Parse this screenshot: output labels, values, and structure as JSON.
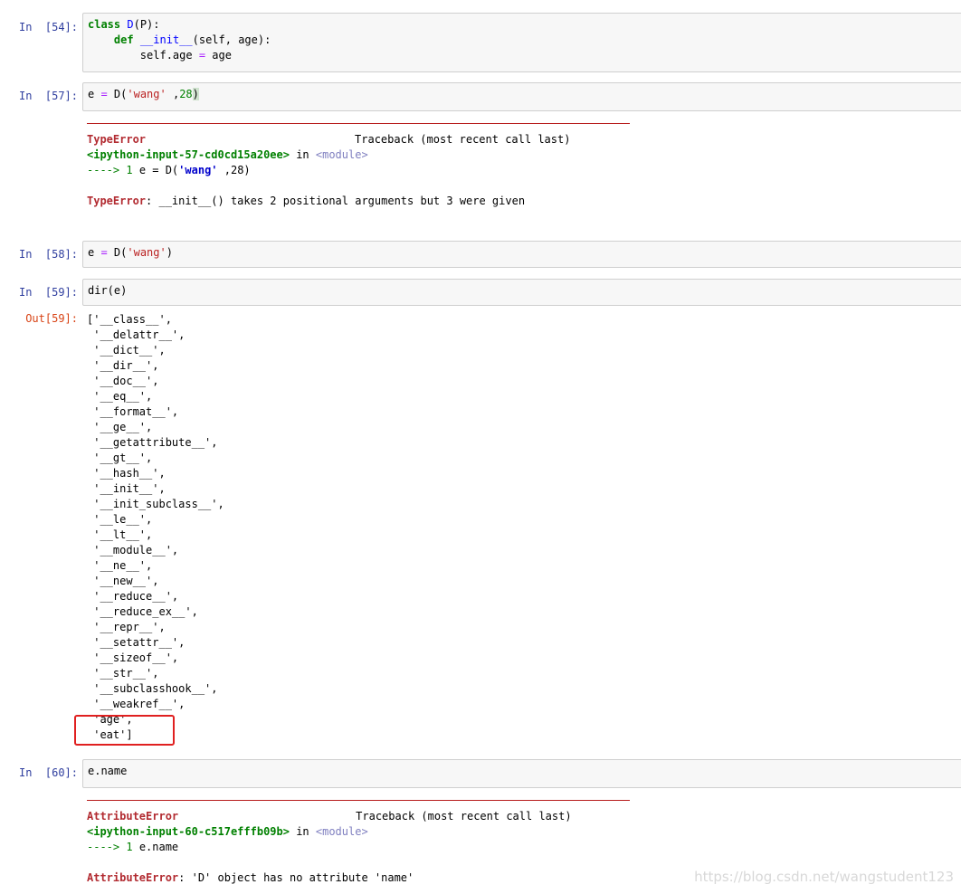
{
  "cells": {
    "c54": {
      "prompt": "In  [54]:",
      "line1": {
        "kw": "class",
        "sp": " ",
        "name": "D",
        "rest": "(P):"
      },
      "line2": {
        "indent": "    ",
        "kw": "def",
        "sp": " ",
        "fn": "__init__",
        "rest": "(self, age):"
      },
      "line3": {
        "indent": "        ",
        "lhs": "self.age ",
        "op": "=",
        "rhs": " age"
      }
    },
    "c57": {
      "prompt": "In  [57]:",
      "code": {
        "lhs": "e ",
        "op": "=",
        "call": " D(",
        "str": "'wang'",
        "sep": " ,",
        "num": "28",
        "close": ")"
      },
      "error": {
        "name": "TypeError",
        "traceback": "Traceback (most recent call last)",
        "input_ref": "<ipython-input-57-cd0cd15a20ee>",
        "in_word": " in ",
        "module": "<module>",
        "arrow": "---->",
        "line_no": " 1 ",
        "line_a": "e = D(",
        "line_str": "'wang'",
        "line_b": " ,28)",
        "message": ": __init__() takes 2 positional arguments but 3 were given"
      }
    },
    "c58": {
      "prompt": "In  [58]:",
      "code": {
        "lhs": "e ",
        "op": "=",
        "call": " D(",
        "str": "'wang'",
        "close": ")"
      }
    },
    "c59": {
      "prompt": "In  [59]:",
      "code": "dir(e)",
      "out_prompt": "Out[59]:",
      "output_lines": [
        "['__class__',",
        " '__delattr__',",
        " '__dict__',",
        " '__dir__',",
        " '__doc__',",
        " '__eq__',",
        " '__format__',",
        " '__ge__',",
        " '__getattribute__',",
        " '__gt__',",
        " '__hash__',",
        " '__init__',",
        " '__init_subclass__',",
        " '__le__',",
        " '__lt__',",
        " '__module__',",
        " '__ne__',",
        " '__new__',",
        " '__reduce__',",
        " '__reduce_ex__',",
        " '__repr__',",
        " '__setattr__',",
        " '__sizeof__',",
        " '__str__',",
        " '__subclasshook__',",
        " '__weakref__',",
        " 'age',",
        " 'eat']"
      ]
    },
    "c60": {
      "prompt": "In  [60]:",
      "code": "e.name",
      "error": {
        "name": "AttributeError",
        "traceback": "Traceback (most recent call last)",
        "input_ref": "<ipython-input-60-c517efffb09b>",
        "in_word": " in ",
        "module": "<module>",
        "arrow": "---->",
        "line_no": " 1 ",
        "line": "e.name",
        "message": ": 'D' object has no attribute 'name'"
      }
    }
  },
  "watermark": "https://blog.csdn.net/wangstudent123",
  "colors": {
    "prompt_in": "#303f9f",
    "prompt_out": "#d84315",
    "highlight_box": "#e02020",
    "error_name": "#b22b31"
  }
}
